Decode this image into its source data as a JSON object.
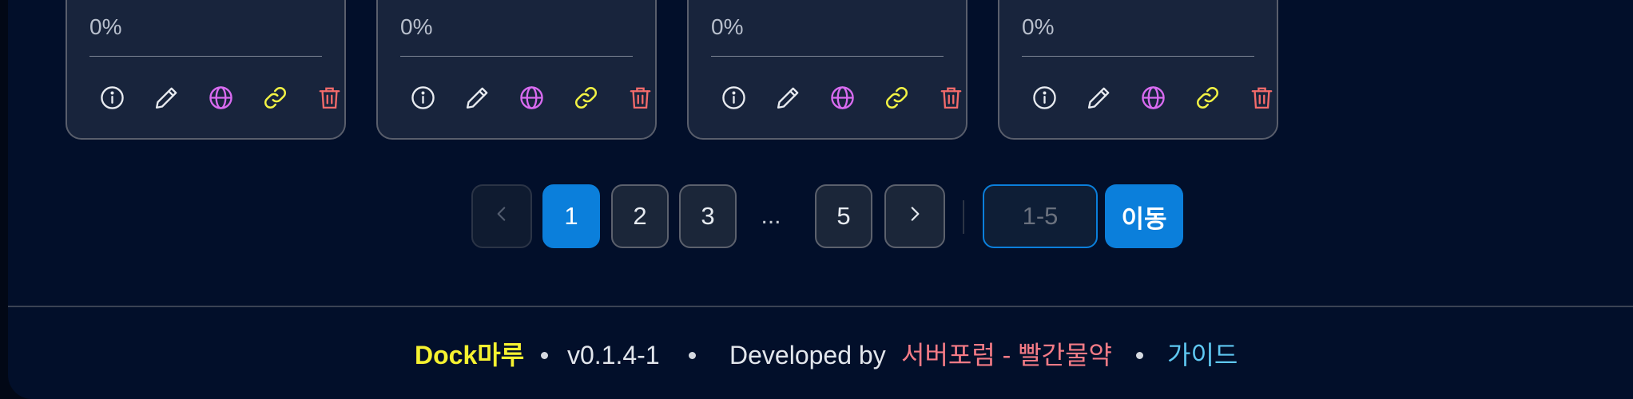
{
  "cards": [
    {
      "progress": "0%",
      "progress_value": 0
    },
    {
      "progress": "0%",
      "progress_value": 0
    },
    {
      "progress": "0%",
      "progress_value": 0
    },
    {
      "progress": "0%",
      "progress_value": 0
    }
  ],
  "card_actions": [
    "info-icon",
    "pencil-icon",
    "globe-icon",
    "link-icon",
    "trash-icon"
  ],
  "colors": {
    "info": "#e8ebf0",
    "edit": "#e8ebf0",
    "globe": "#d86bf0",
    "link": "#f2f244",
    "trash": "#f36b6b",
    "accent": "#0b7fdb",
    "brand": "#f6f230",
    "author": "#f47b86",
    "guide": "#5fc8f2"
  },
  "pagination": {
    "prev_icon": "chevron-left-icon",
    "next_icon": "chevron-right-icon",
    "pages": [
      "1",
      "2",
      "3",
      "5"
    ],
    "current": "1",
    "ellipsis": "...",
    "goto_placeholder": "1-5",
    "goto_label": "이동"
  },
  "footer": {
    "brand": "Dock마루",
    "version": "v0.1.4-1",
    "developed_by": "Developed by",
    "author": "서버포럼 - 빨간물약",
    "guide": "가이드"
  }
}
